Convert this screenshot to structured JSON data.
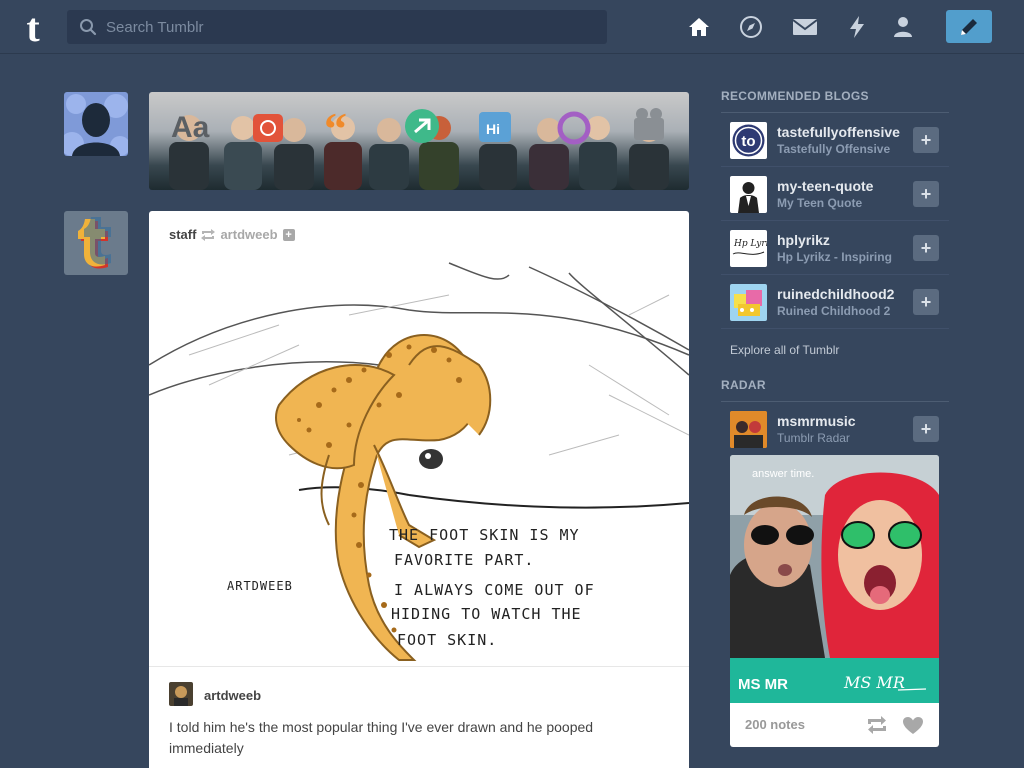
{
  "header": {
    "logo_letter": "t",
    "search_placeholder": "Search Tumblr",
    "icons": [
      "home-icon",
      "explore-icon",
      "inbox-icon",
      "activity-icon",
      "account-icon",
      "compose-icon"
    ]
  },
  "post": {
    "author": "staff",
    "reblogged_from": "artdweeb",
    "follow_label": "+",
    "reblog_author": "artdweeb",
    "caption": "I told him he's the most popular thing I've ever drawn and he pooped immediately",
    "art_text": {
      "signature": "ARTDWEEB",
      "line1": "THE  FOOT  SKIN  IS  MY",
      "line2": "FAVORITE  PART.",
      "line3": "I  ALWAYS  COME  OUT OF",
      "line4": "HIDING  TO  WATCH  THE",
      "line5": "FOOT  SKIN."
    }
  },
  "recommended": {
    "title": "RECOMMENDED BLOGS",
    "items": [
      {
        "name": "tastefullyoffensive",
        "sub": "Tastefully Offensive",
        "avatar_text": "to",
        "add_label": "+"
      },
      {
        "name": "my-teen-quote",
        "sub": "My Teen Quote",
        "add_label": "+"
      },
      {
        "name": "hplyrikz",
        "sub": "Hp Lyrikz - Inspiring",
        "avatar_text": "Hp Lyrikz",
        "add_label": "+"
      },
      {
        "name": "ruinedchildhood2",
        "sub": "Ruined Childhood 2",
        "add_label": "+"
      }
    ],
    "explore_label": "Explore all of Tumblr"
  },
  "radar": {
    "title": "RADAR",
    "blog_name": "msmrmusic",
    "blog_sub": "Tumblr Radar",
    "add_label": "+",
    "photo_overlay": "answer time.",
    "band_label": "MS MR",
    "band_script": "MS MR",
    "notes": "200 notes"
  },
  "colors": {
    "background": "#36465d",
    "accent": "#529ecc",
    "radar_green": "#1fb79a"
  }
}
